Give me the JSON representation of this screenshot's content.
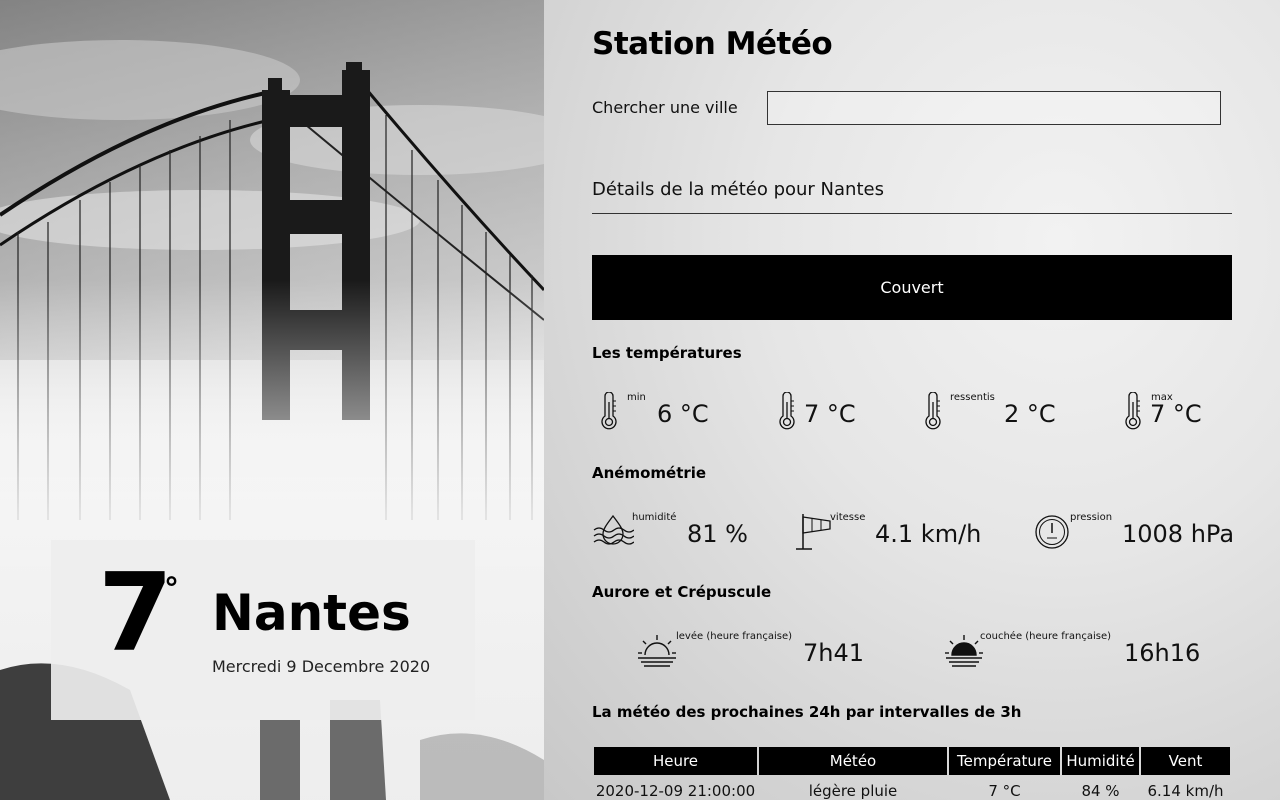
{
  "app": {
    "title": "Station Météo"
  },
  "search": {
    "label": "Chercher une ville",
    "value": "",
    "placeholder": ""
  },
  "current": {
    "temperature": "7",
    "degree_symbol": "°",
    "city": "Nantes",
    "date": "Mercredi 9 Decembre 2020",
    "details_title": "Détails de la météo pour Nantes",
    "condition": "Couvert"
  },
  "temperatures": {
    "title": "Les températures",
    "items": [
      {
        "label": "min",
        "value": "6 °C",
        "icon": "thermometer-icon"
      },
      {
        "label": "",
        "value": "7 °C",
        "icon": "thermometer-icon"
      },
      {
        "label": "ressentis",
        "value": "2 °C",
        "icon": "thermometer-icon"
      },
      {
        "label": "max",
        "value": "7 °C",
        "icon": "thermometer-icon"
      }
    ]
  },
  "anemometry": {
    "title": "Anémométrie",
    "items": [
      {
        "label": "humidité",
        "value": "81 %",
        "icon": "humidity-icon"
      },
      {
        "label": "vitesse",
        "value": "4.1 km/h",
        "icon": "windsock-icon"
      },
      {
        "label": "pression",
        "value": "1008 hPa",
        "icon": "barometer-icon"
      }
    ]
  },
  "sun": {
    "title": "Aurore et Crépuscule",
    "items": [
      {
        "label": "levée (heure française)",
        "value": "7h41",
        "icon": "sunrise-icon"
      },
      {
        "label": "couchée (heure française)",
        "value": "16h16",
        "icon": "sunset-icon"
      }
    ]
  },
  "forecast": {
    "title": "La météo des prochaines 24h par intervalles de 3h",
    "headers": [
      "Heure",
      "Météo",
      "Température",
      "Humidité",
      "Vent"
    ],
    "rows": [
      [
        "2020-12-09 21:00:00",
        "légère pluie",
        "7 °C",
        "84 %",
        "6.14 km/h"
      ]
    ]
  }
}
